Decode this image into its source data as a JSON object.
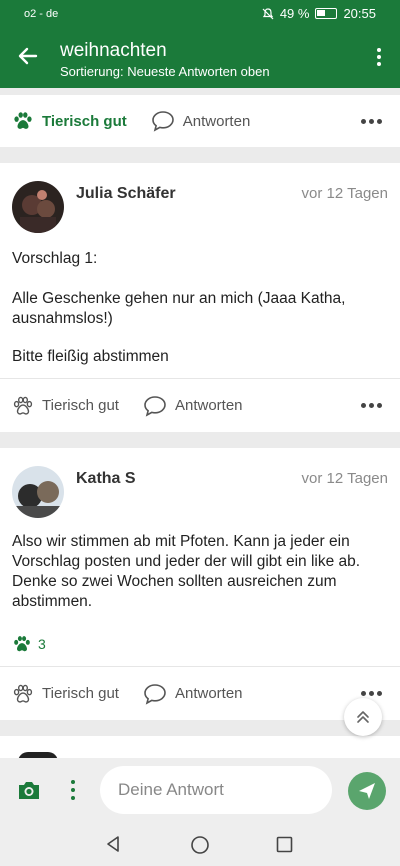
{
  "status": {
    "carrier": "o2 - de",
    "battery": "49 %",
    "time": "20:55"
  },
  "header": {
    "title": "weihnachten",
    "subtitle": "Sortierung: Neueste Antworten oben"
  },
  "top_actions": {
    "like": "Tierisch gut",
    "reply": "Antworten"
  },
  "posts": [
    {
      "author": "Julia Schäfer",
      "date": "vor 12 Tagen",
      "lines": [
        "Vorschlag 1:",
        "Alle Geschenke gehen nur an mich (Jaaa Katha, ausnahmslos!)",
        "Bitte fleißig abstimmen"
      ],
      "like": "Tierisch gut",
      "reply": "Antworten"
    },
    {
      "author": "Katha S",
      "date": "vor 12 Tagen",
      "lines": [
        "Also wir stimmen ab mit Pfoten. Kann ja jeder ein Vorschlag posten und jeder der will gibt ein like ab. Denke so zwei Wochen sollten ausreichen zum abstimmen."
      ],
      "likes_count": "3",
      "like": "Tierisch gut",
      "reply": "Antworten"
    }
  ],
  "composer": {
    "placeholder": "Deine Antwort"
  },
  "colors": {
    "primary": "#1b7a3a",
    "send": "#5aa56d"
  }
}
